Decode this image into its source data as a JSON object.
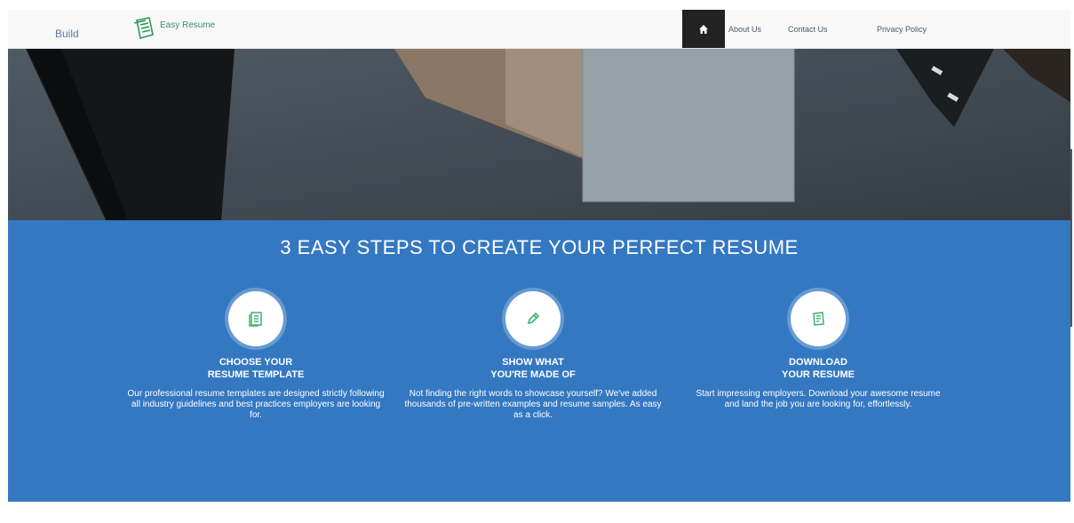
{
  "nav": {
    "build_label": "Build",
    "brand_name": "Easy Resume",
    "home_icon": "home-icon",
    "links": [
      "About Us",
      "Contact Us",
      "Privacy Policy"
    ]
  },
  "steps": {
    "title": "3 EASY STEPS TO CREATE YOUR PERFECT RESUME",
    "items": [
      {
        "icon": "resume-icon",
        "title_line1": "CHOOSE YOUR",
        "title_line2": "RESUME TEMPLATE",
        "description": "Our professional resume templates are designed strictly following all industry guidelines and best practices employers are looking for."
      },
      {
        "icon": "pencil-icon",
        "title_line1": "SHOW WHAT",
        "title_line2": "YOU'RE MADE OF",
        "description": "Not finding the right words to showcase yourself? We've added thousands of pre-written examples and resume samples. As easy as a click."
      },
      {
        "icon": "download-resume-icon",
        "title_line1": "DOWNLOAD",
        "title_line2": "YOUR RESUME",
        "description": "Start impressing employers. Download your awesome resume and land the job you are looking for, effortlessly."
      }
    ]
  },
  "colors": {
    "accent": "#3478c2",
    "icon_green": "#3cb371",
    "nav_bg": "#f8f8f8",
    "home_bg": "#222222"
  }
}
